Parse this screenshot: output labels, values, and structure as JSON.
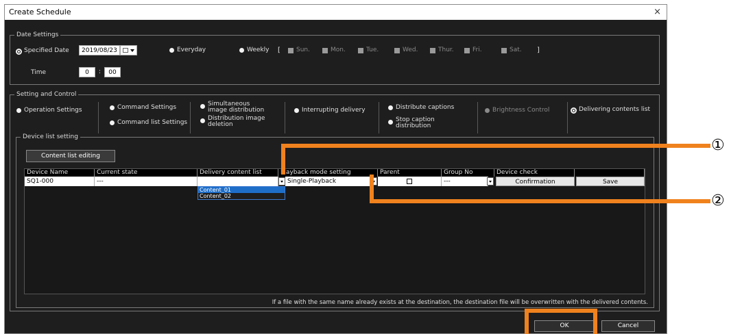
{
  "window": {
    "title": "Create Schedule",
    "close": "×"
  },
  "date_settings": {
    "group_label": "Date Settings",
    "specified_date": "Specified Date",
    "date_value": "2019/08/23",
    "everyday": "Everyday",
    "weekly": "Weekly",
    "bracket_open": "[",
    "bracket_close": "]",
    "days": [
      "Sun.",
      "Mon.",
      "Tue.",
      "Wed.",
      "Thur.",
      "Fri.",
      "Sat."
    ],
    "time_label": "Time",
    "hour": "0",
    "colon": ":",
    "minute": "00"
  },
  "setting_control": {
    "group_label": "Setting and Control",
    "operation_settings": "Operation Settings",
    "command_settings": "Command Settings",
    "command_list_settings": "Command list Settings",
    "simultaneous_line1": "Simultaneous",
    "simultaneous_line2": "image distribution",
    "distribution_deletion_line1": "Distribution image",
    "distribution_deletion_line2": "deletion",
    "interrupting_delivery": "Interrupting delivery",
    "distribute_captions": "Distribute captions",
    "stop_caption_line1": "Stop caption",
    "stop_caption_line2": "distribution",
    "brightness_control": "Brightness Control",
    "delivering_contents_list": "Delivering contents list"
  },
  "device_list": {
    "group_label": "Device list setting",
    "content_list_editing": "Content list editing",
    "columns": [
      "Device Name",
      "Current state",
      "Delivery content list",
      "Playback mode setting",
      "Parent",
      "Group No",
      "Device check",
      ""
    ],
    "row": {
      "device_name": "SQ1-000",
      "current_state": "---",
      "delivery_content": "",
      "playback_mode": "Single-Playback",
      "group_no": "---",
      "confirmation": "Confirmation",
      "save": "Save"
    },
    "dropdown_options": [
      "Content_01",
      "Content_02"
    ],
    "note": "If a file with the same name already exists at the destination, the destination file will be overwritten with the delivered contents."
  },
  "footer": {
    "ok": "OK",
    "cancel": "Cancel"
  },
  "callouts": {
    "one": "①",
    "two": "②"
  },
  "colors": {
    "highlight": "#f0821e",
    "background": "#1e1e1e",
    "selection": "#1e6ec8"
  }
}
